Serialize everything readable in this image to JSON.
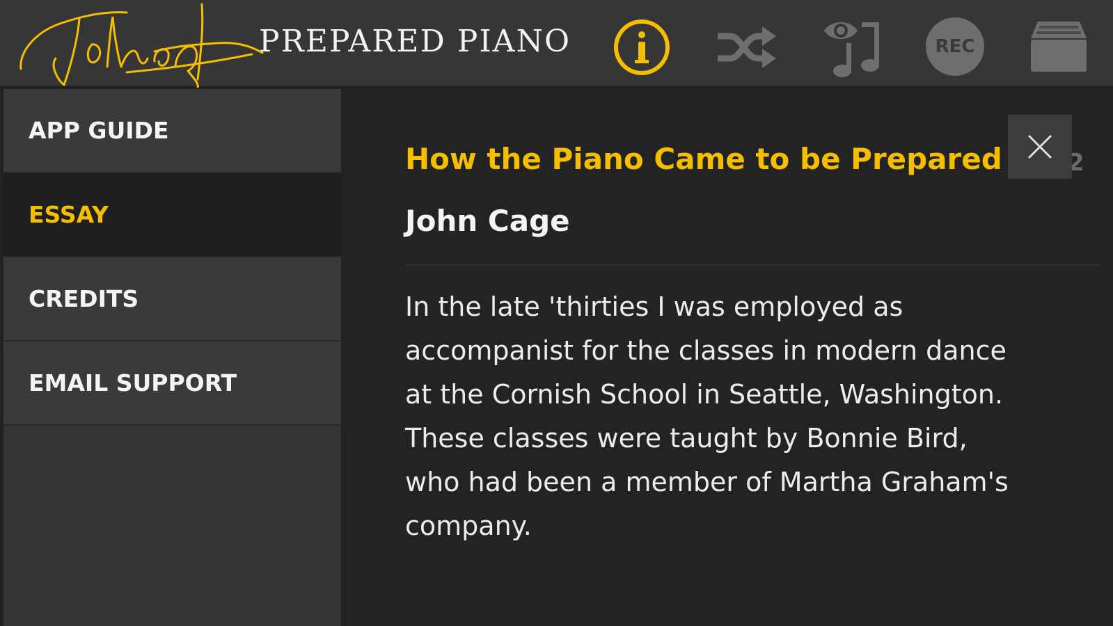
{
  "header": {
    "app_title": "PREPARED PIANO",
    "signature_text": "John Cage",
    "rec_label": "REC",
    "icons": [
      "signature-logo",
      "info-icon",
      "shuffle-icon",
      "preview-music-icon",
      "record-icon",
      "box-icon"
    ]
  },
  "colors": {
    "accent": "#f5be00",
    "topbar": "#363636",
    "sidebar": "#3a3a3a",
    "sidebar_active": "#1f1f1f",
    "content_bg": "#232323",
    "icon_gray": "#6e6e6e"
  },
  "sidebar": {
    "items": [
      {
        "label": "APP GUIDE",
        "active": false
      },
      {
        "label": "ESSAY",
        "active": true
      },
      {
        "label": "CREDITS",
        "active": false
      },
      {
        "label": "EMAIL SUPPORT",
        "active": false
      }
    ]
  },
  "essay": {
    "title": "How the Piano Came to be Prepared",
    "author": "John Cage",
    "body": "In the late 'thirties I was employed as accompanist for the classes in modern dance at the Cornish School in Seattle, Washington. These classes were taught by Bonnie Bird, who had been a member of Martha Graham's company.",
    "page_indicator": "2",
    "close_icon": "close-icon"
  }
}
